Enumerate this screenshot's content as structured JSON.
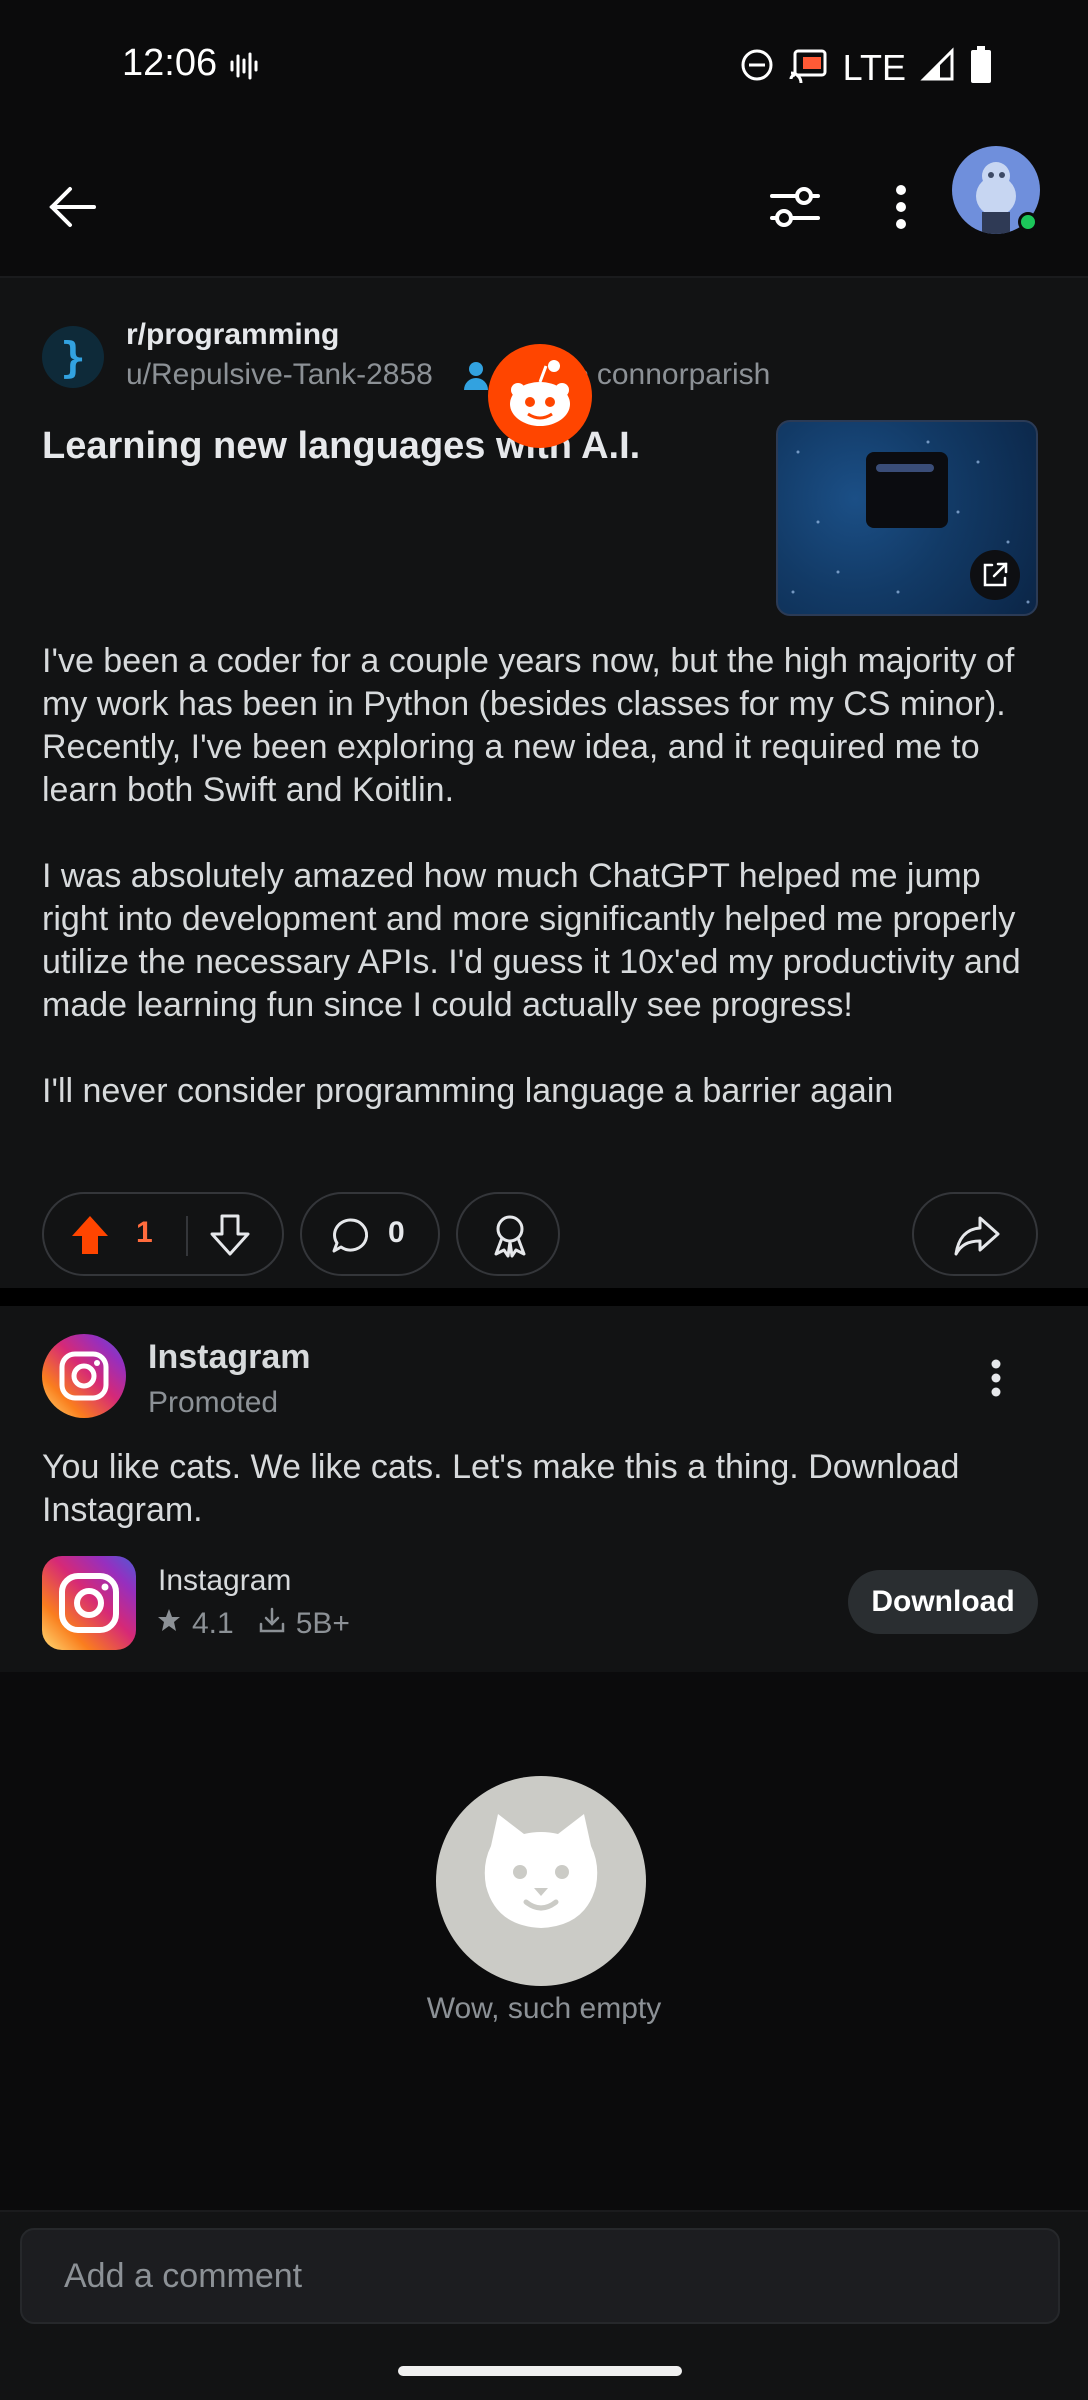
{
  "status_bar": {
    "time": "12:06",
    "network": "LTE",
    "icons": [
      "sound-wave-icon",
      "do-not-disturb-icon",
      "cast-icon",
      "signal-icon",
      "battery-icon"
    ]
  },
  "topbar": {
    "icons": [
      "back-arrow-icon",
      "filter-icon",
      "more-vertical-icon",
      "avatar"
    ]
  },
  "post": {
    "subreddit": "r/programming",
    "author": "u/Repulsive-Tank-2858",
    "separator": "•",
    "domain": "connorparish",
    "title": "Learning new languages with A.I.",
    "body": [
      "I've been a coder for a couple years now, but the high majority of my work has been in Python (besides classes for my CS minor). Recently, I've been exploring a new idea, and it required me to learn both Swift and Koitlin.",
      "I was absolutely amazed how much ChatGPT helped me jump right into development and more significantly helped me properly utilize the necessary APIs. I'd guess it 10x'ed my productivity and made learning fun since I could actually see progress!",
      "I'll never consider programming language a barrier again"
    ],
    "upvotes": "1",
    "comments": "0",
    "colors": {
      "upvote": "#ff4500",
      "accent": "#32a2e0"
    }
  },
  "ad": {
    "advertiser": "Instagram",
    "promoted": "Promoted",
    "text": "You like cats. We like cats. Let's make this a thing. Download Instagram.",
    "app_name": "Instagram",
    "rating": "4.1",
    "downloads": "5B+",
    "button": "Download"
  },
  "empty_state": {
    "text": "Wow, such empty"
  },
  "comment_bar": {
    "placeholder": "Add a comment"
  }
}
